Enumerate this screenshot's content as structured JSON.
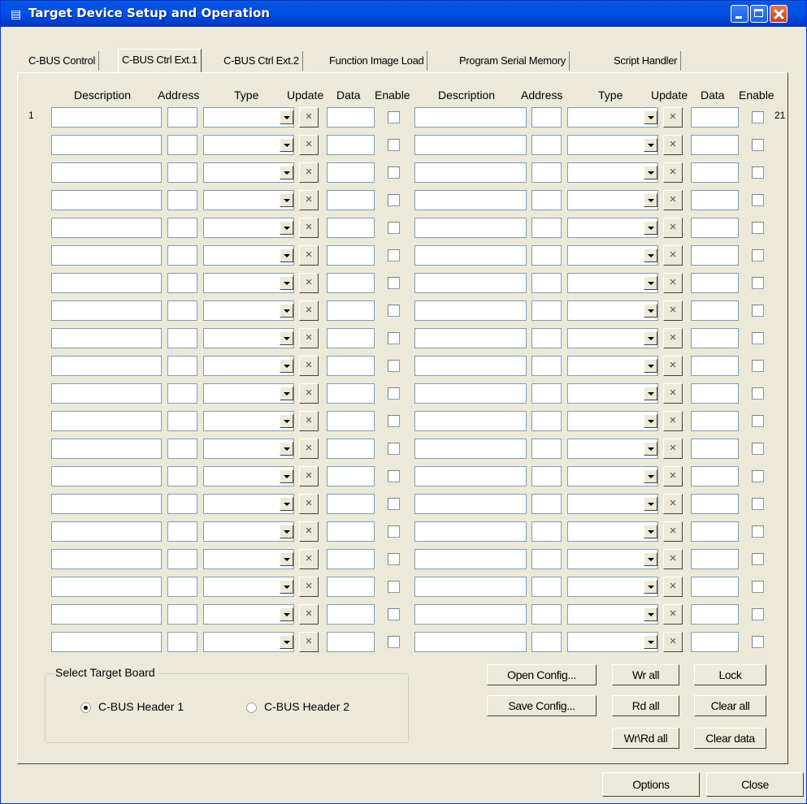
{
  "window": {
    "title": "Target Device Setup and Operation",
    "icon": "app-icon"
  },
  "tabs": [
    {
      "label": "C-BUS Control",
      "active": false
    },
    {
      "label": "C-BUS Ctrl Ext.1",
      "active": true
    },
    {
      "label": "C-BUS Ctrl Ext.2",
      "active": false
    },
    {
      "label": "Function Image Load",
      "active": false
    },
    {
      "label": "Program Serial Memory",
      "active": false
    },
    {
      "label": "Script Handler",
      "active": false
    }
  ],
  "columns": {
    "description": "Description",
    "address": "Address",
    "type": "Type",
    "update": "Update",
    "data": "Data",
    "enable": "Enable"
  },
  "row_labels": {
    "left_first": "1",
    "right_first": "21"
  },
  "update_glyph": "×",
  "row_count": 20,
  "target_board": {
    "legend": "Select Target Board",
    "options": [
      {
        "label": "C-BUS Header 1",
        "selected": true
      },
      {
        "label": "C-BUS Header 2",
        "selected": false
      }
    ]
  },
  "buttons": {
    "open_config": "Open Config...",
    "save_config": "Save Config...",
    "wr_all": "Wr all",
    "rd_all": "Rd all",
    "wr_rd_all": "Wr\\Rd all",
    "lock": "Lock",
    "clear_all": "Clear all",
    "clear_data": "Clear data",
    "options": "Options",
    "close": "Close"
  }
}
